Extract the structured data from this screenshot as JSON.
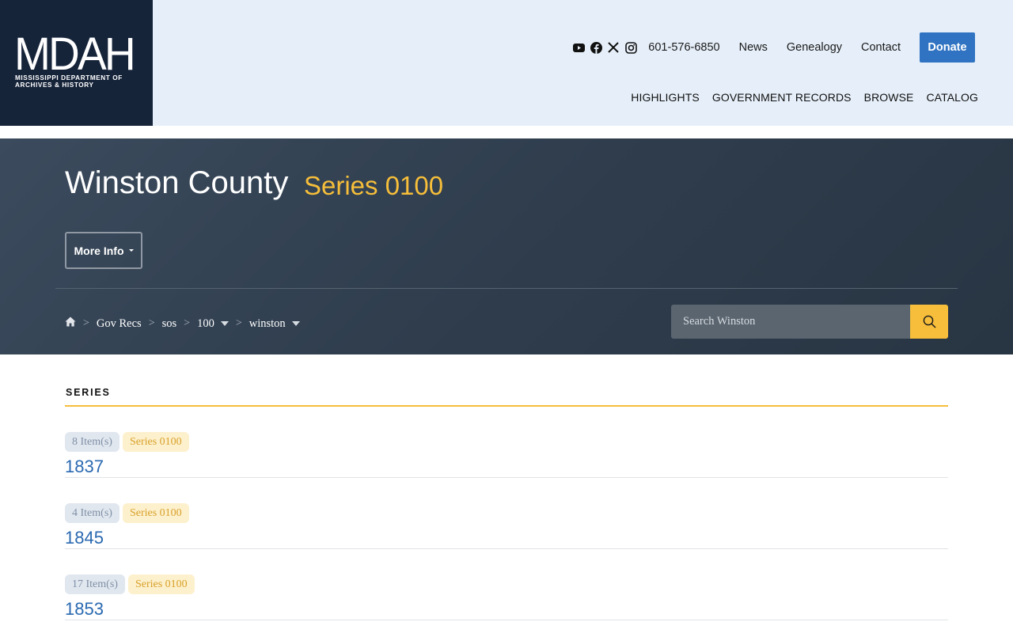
{
  "header": {
    "logo": {
      "mark": "MDAH",
      "line1": "MISSISSIPPI DEPARTMENT OF",
      "line2": "ARCHIVES & HISTORY"
    },
    "social_icons": [
      "youtube-icon",
      "facebook-icon",
      "x-icon",
      "instagram-icon"
    ],
    "phone": "601-576-6850",
    "links": [
      "News",
      "Genealogy",
      "Contact"
    ],
    "donate_label": "Donate",
    "nav": [
      "HIGHLIGHTS",
      "GOVERNMENT RECORDS",
      "BROWSE",
      "CATALOG"
    ]
  },
  "hero": {
    "title": "Winston County",
    "series": "Series 0100",
    "more_info": "More Info",
    "breadcrumb": [
      "Gov Recs",
      "sos",
      "100",
      "winston"
    ],
    "search_placeholder": "Search Winston"
  },
  "section": {
    "label": "SERIES"
  },
  "rows": [
    {
      "count": "8 Item(s)",
      "series": "Series 0100",
      "year": "1837"
    },
    {
      "count": "4 Item(s)",
      "series": "Series 0100",
      "year": "1845"
    },
    {
      "count": "17 Item(s)",
      "series": "Series 0100",
      "year": "1853"
    }
  ],
  "colors": {
    "logo_bg": "#16243a",
    "header_bg": "#e6eff9",
    "accent": "#f6be3a",
    "link_blue": "#2a69b1",
    "donate": "#2f73c2"
  }
}
